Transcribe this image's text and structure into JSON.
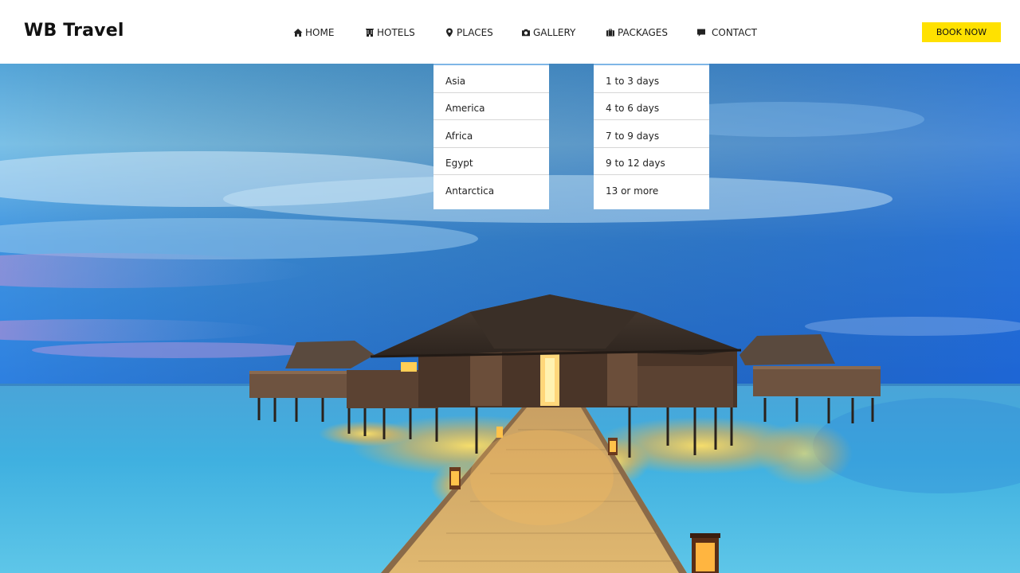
{
  "brand": {
    "name": "WB Travel"
  },
  "nav": {
    "home": "HOME",
    "hotels": "HOTELS",
    "places": "PLACES",
    "gallery": "GALLERY",
    "packages": "PACKAGES",
    "contact": "CONTACT"
  },
  "cta": {
    "book_now": "BOOK NOW",
    "color": "#ffe100"
  },
  "dropdowns": {
    "places": [
      "Asia",
      "America",
      "Africa",
      "Egypt",
      "Antarctica"
    ],
    "packages": [
      "1 to 3 days",
      "4 to 6 days",
      "7 to 9 days",
      "9 to 12 days",
      "13 or more"
    ]
  },
  "icons": {
    "home": "home-icon",
    "hotels": "building-icon",
    "places": "map-marker-icon",
    "gallery": "camera-icon",
    "packages": "suitcase-icon",
    "contact": "comment-icon"
  }
}
